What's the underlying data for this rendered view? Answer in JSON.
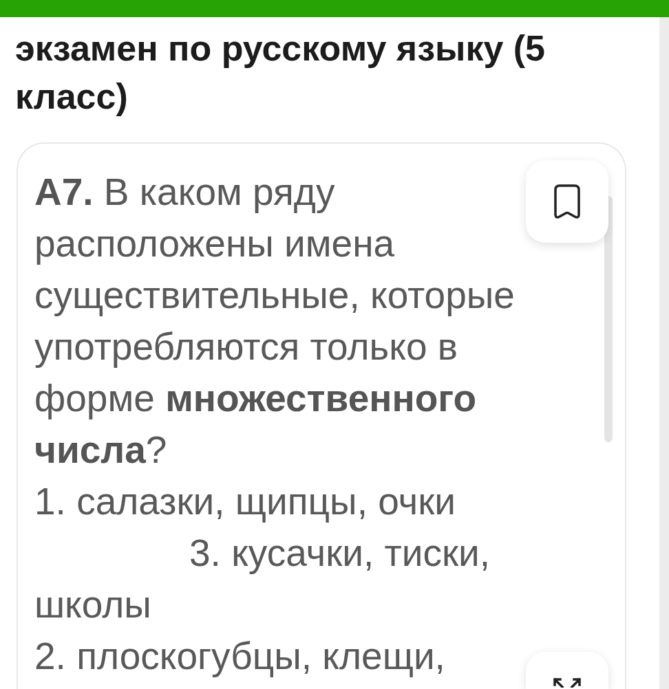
{
  "page_title": "экзамен по русскому языку (5 класс)",
  "question": {
    "text": "**A7.** В каком ряду расположены имена существительные, которые употребляются только в форме **множественного числа**?",
    "option_rows": [
      [
        "1. салазки, щипцы, очки",
        "3. кусачки, тиски, школы"
      ],
      [
        "2. плоскогубцы, клещи,"
      ]
    ],
    "bookmarked": false
  }
}
